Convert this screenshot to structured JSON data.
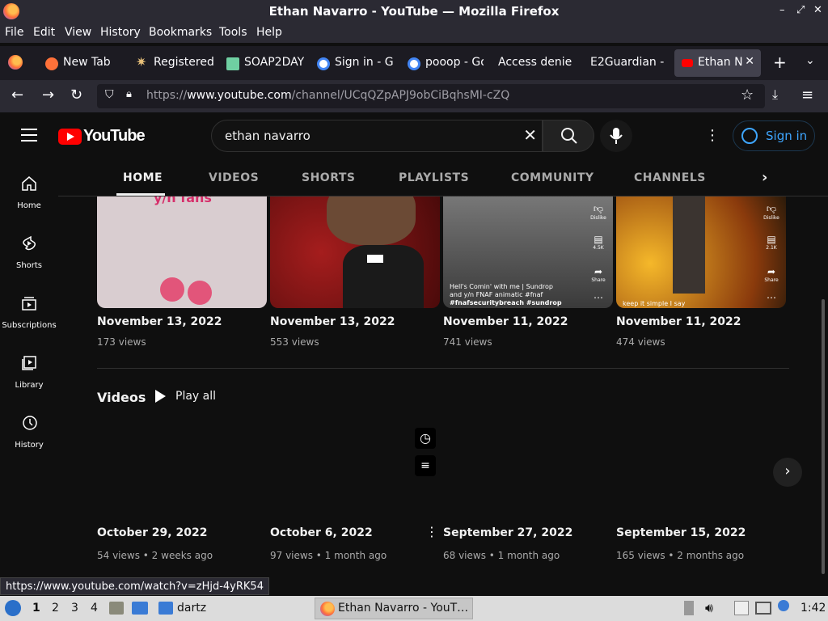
{
  "window": {
    "title": "Ethan Navarro - YouTube — Mozilla Firefox",
    "controls": [
      "–",
      "⤢",
      "✕"
    ]
  },
  "menu": [
    "File",
    "Edit",
    "View",
    "History",
    "Bookmarks",
    "Tools",
    "Help"
  ],
  "tabs": [
    {
      "label": "New Tab",
      "icon": "firefox-icon",
      "color": "#ff7139"
    },
    {
      "label": "Registered",
      "icon": "star-burst-icon",
      "color": "#e8c07a"
    },
    {
      "label": "SOAP2DAY",
      "icon": "soap2day-icon",
      "color": "#6fcfa2"
    },
    {
      "label": "Sign in - G",
      "icon": "google-icon",
      "color": "#4285f4"
    },
    {
      "label": "pooop - Go",
      "icon": "google-icon",
      "color": "#4285f4"
    },
    {
      "label": "Access denie",
      "icon": "",
      "color": ""
    },
    {
      "label": "E2Guardian -",
      "icon": "",
      "color": ""
    },
    {
      "label": "Ethan N",
      "icon": "youtube-icon",
      "color": "#ff0000",
      "active": true
    }
  ],
  "address": {
    "prefix": "https://",
    "host": "www.youtube.com",
    "path": "/channel/UCqQZpAPJ9obCiBqhsMI-cZQ"
  },
  "youtube": {
    "logo_text": "YouTube",
    "search_value": "ethan navarro",
    "sign_in": "Sign in",
    "sidebar": [
      "Home",
      "Shorts",
      "Subscriptions",
      "Library",
      "History"
    ],
    "channel_tabs": [
      "HOME",
      "VIDEOS",
      "SHORTS",
      "PLAYLISTS",
      "COMMUNITY",
      "CHANNELS"
    ],
    "shorts_row": [
      {
        "date": "November 13, 2022",
        "views": "173 views",
        "overlay": "y/n fans"
      },
      {
        "date": "November 13, 2022",
        "views": "553 views"
      },
      {
        "date": "November 11, 2022",
        "views": "741 views",
        "caption": [
          "Hell's Comin' with me | Sundrop",
          "and y/n FNAF animatic #fnaf",
          "#fnafsecuritybreach #sundrop"
        ],
        "actions": [
          "Dislike",
          "4.5K",
          "Share"
        ]
      },
      {
        "date": "November 11, 2022",
        "views": "474 views",
        "caption": [
          "keep it simple I say"
        ],
        "actions": [
          "Dislike",
          "2.1K",
          "Share"
        ]
      }
    ],
    "videos_section": {
      "title": "Videos",
      "play_all": "Play all",
      "items": [
        {
          "date": "October 29, 2022",
          "meta": "54 views • 2 weeks ago"
        },
        {
          "date": "October 6, 2022",
          "meta": "97 views • 1 month ago"
        },
        {
          "date": "September 27, 2022",
          "meta": "68 views • 1 month ago"
        },
        {
          "date": "September 15, 2022",
          "meta": "165 views • 2 months ago"
        }
      ]
    }
  },
  "status_link": "https://www.youtube.com/watch?v=zHjd-4yRK54",
  "taskbar": {
    "workspaces": [
      "1",
      "2",
      "3",
      "4"
    ],
    "folder": "dartz",
    "window_label": "Ethan Navarro - YouT…",
    "clock": "1:42"
  }
}
